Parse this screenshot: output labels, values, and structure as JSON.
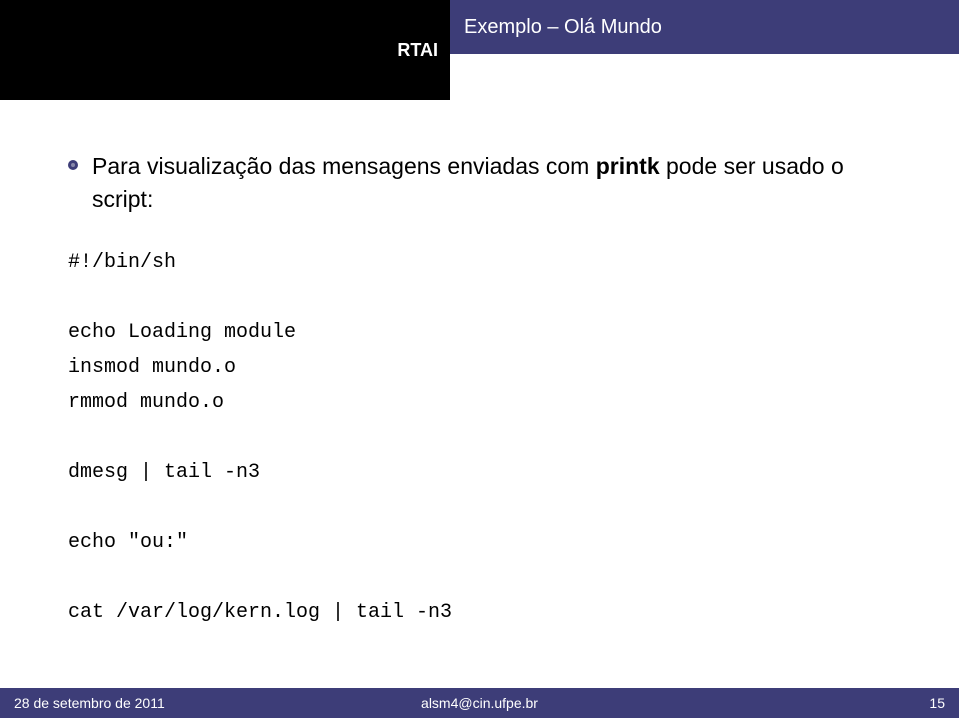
{
  "header": {
    "left": "RTAI",
    "right": "Exemplo – Olá Mundo"
  },
  "body": {
    "para_prefix": "Para visualização das mensagens enviadas com ",
    "printk": "printk",
    "para_suffix": " pode ser usado o script:",
    "code": "#!/bin/sh\n\necho Loading module\ninsmod mundo.o\nrmmod mundo.o\n\ndmesg | tail -n3\n\necho \"ou:\"\n\ncat /var/log/kern.log | tail -n3"
  },
  "footer": {
    "left": "28 de setembro de 2011",
    "center": "alsm4@cin.ufpe.br",
    "right": "15"
  }
}
